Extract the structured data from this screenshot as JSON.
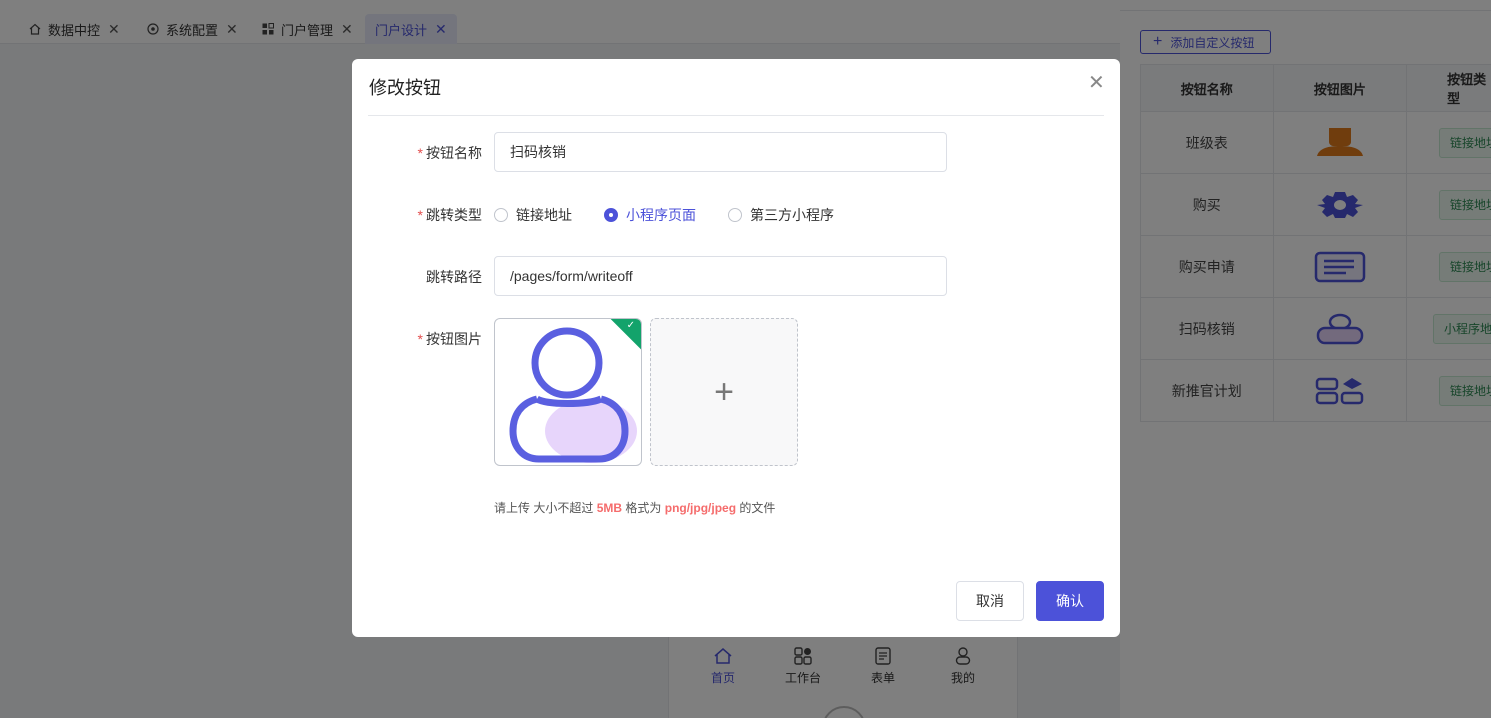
{
  "tabs": [
    {
      "label": "数据中控",
      "icon": "home-icon"
    },
    {
      "label": "系统配置",
      "icon": "settings-icon"
    },
    {
      "label": "门户管理",
      "icon": "grid-icon"
    },
    {
      "label": "门户设计",
      "icon": "",
      "active": true
    }
  ],
  "phone_nav": [
    {
      "label": "首页",
      "icon": "home-icon",
      "active": true
    },
    {
      "label": "工作台",
      "icon": "apps-icon"
    },
    {
      "label": "表单",
      "icon": "form-icon"
    },
    {
      "label": "我的",
      "icon": "user-icon"
    }
  ],
  "right_panel": {
    "add_button": "添加自定义按钮",
    "columns": [
      "按钮名称",
      "按钮图片",
      "按钮类型"
    ],
    "rows": [
      {
        "name": "班级表",
        "icon": "person-icon",
        "type": "链接地址"
      },
      {
        "name": "购买",
        "icon": "gear-icon",
        "type": "链接地址"
      },
      {
        "name": "购买申请",
        "icon": "document-icon",
        "type": "链接地址"
      },
      {
        "name": "扫码核销",
        "icon": "person-icon",
        "type": "小程序地址"
      },
      {
        "name": "新推官计划",
        "icon": "apps-icon",
        "type": "链接地址"
      }
    ]
  },
  "dialog": {
    "title": "修改按钮",
    "close_icon": "close-icon",
    "fields": {
      "name_label": "按钮名称",
      "name_value": "扫码核销",
      "type_label": "跳转类型",
      "type_options": [
        "链接地址",
        "小程序页面",
        "第三方小程序"
      ],
      "type_selected": "小程序页面",
      "path_label": "跳转路径",
      "path_value": "/pages/form/writeoff",
      "image_label": "按钮图片"
    },
    "hint": {
      "p1": "请上传 大小不超过",
      "size": "5MB",
      "p2": "格式为",
      "formats": "png/jpg/jpeg",
      "p3": "的文件"
    },
    "cancel_label": "取消",
    "ok_label": "确认"
  },
  "colors": {
    "accent": "#4c52d9",
    "required": "#e34d4d",
    "success": "#13a36b",
    "hint_emphasis": "#f56c6c"
  }
}
